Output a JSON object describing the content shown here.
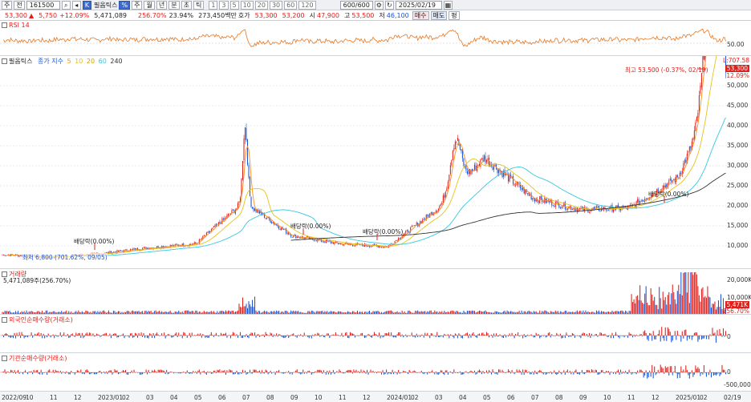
{
  "toolbar": {
    "menu": "주",
    "btn_jeon": "전",
    "code": "161500",
    "search_icon": "search-icon",
    "nav_icon": "arrow-left-icon",
    "type_badge": "K",
    "name": "필옵틱스",
    "btn_per": "%",
    "periods": [
      "주",
      "월",
      "년",
      "분",
      "초",
      "틱"
    ],
    "minutes": [
      "1",
      "3",
      "5",
      "10",
      "20",
      "30",
      "60",
      "120"
    ],
    "count": "600/600",
    "date": "2025/02/19"
  },
  "quote": {
    "price": "53,300",
    "arrow": "▲",
    "change": "5,750",
    "change_pct": "+12.09%",
    "volume": "5,471,089",
    "vol_ratio": "256.70%",
    "turnover": "23.94%",
    "amount": "273,450백만",
    "hoga_label": "호가",
    "hoga_ask": "53,300",
    "hoga_bid": "53,200",
    "open_label": "시",
    "open": "47,900",
    "high_label": "고",
    "high": "53,500",
    "low_label": "저",
    "low": "46,100",
    "buy_label": "매수",
    "sell_label": "매도",
    "last_label": "평"
  },
  "rsi": {
    "title": "RSI 14",
    "ticks": [
      "50.00"
    ]
  },
  "price_pane": {
    "title": "필옵틱스",
    "ma_label": "종가 지수",
    "ma": [
      "5",
      "10",
      "20",
      "60",
      "240"
    ],
    "high_annot": "최고 53,500 (-0.37%, 02/19)",
    "low_annot": "최저 6,800 (701.62%, 09/05)",
    "right_labels": [
      "L:707.58",
      "53,300",
      "12.09%"
    ],
    "ticks": [
      "50,000",
      "45,000",
      "40,000",
      "35,000",
      "30,000",
      "25,000",
      "20,000",
      "15,000",
      "10,000"
    ],
    "events": [
      "배당락(0.00%)",
      "배당락(0.00%)",
      "배당락(0.00%)",
      "배당락(0.00%)"
    ]
  },
  "volume_pane": {
    "title": "거래량",
    "sub": "5,471,089주(256.70%)",
    "ticks": [
      "20,000K",
      "10,000K"
    ],
    "right_labels": [
      "5,471K",
      "256.70%"
    ]
  },
  "foreign_pane": {
    "title": "외국인순매수량(거래소)",
    "ticks": [
      "0"
    ]
  },
  "inst_pane": {
    "title": "기관순매수량(거래소)",
    "ticks": [
      "0",
      "-500,000"
    ]
  },
  "xaxis": [
    "2022/09",
    "10",
    "11",
    "12",
    "2023/01",
    "02",
    "03",
    "04",
    "05",
    "06",
    "07",
    "08",
    "09",
    "10",
    "11",
    "12",
    "2024/01",
    "02",
    "03",
    "04",
    "05",
    "06",
    "07",
    "08",
    "09",
    "10",
    "11",
    "12",
    "2025/01",
    "02",
    "02/19"
  ],
  "colors": {
    "up": "#e0201b",
    "down": "#1a55d6",
    "rsi": "#e87722",
    "ma5": "#ff8c1a",
    "ma20": "#e6c21a",
    "ma60": "#35c8e0",
    "ma240": "#333333"
  },
  "chart_data": {
    "type": "line",
    "title": "필옵틱스",
    "x": [
      "2022/09",
      "2022/11",
      "2023/01",
      "2023/03",
      "2023/05",
      "2023/07",
      "2023/09",
      "2023/11",
      "2024/01",
      "2024/03",
      "2024/05",
      "2024/07",
      "2024/09",
      "2024/11",
      "2025/01",
      "2025/02/19"
    ],
    "series": [
      {
        "name": "종가",
        "values": [
          7800,
          7200,
          8000,
          9500,
          10500,
          21000,
          12500,
          10500,
          9800,
          19000,
          32000,
          22000,
          19000,
          19500,
          27000,
          53300
        ]
      }
    ],
    "ylim": [
      5000,
      55000
    ],
    "grid": true
  }
}
